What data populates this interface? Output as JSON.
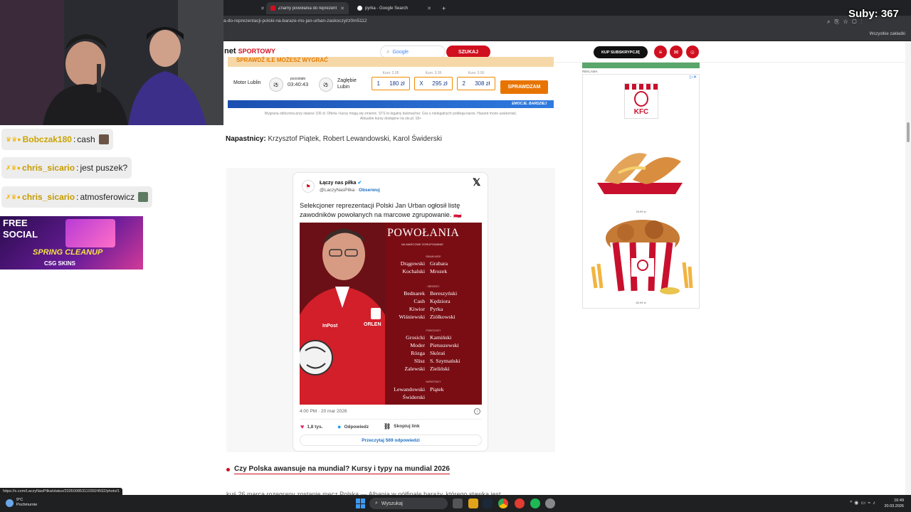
{
  "browser": {
    "tabs": [
      {
        "title": "Znamy powołania do reprezent",
        "active": true
      },
      {
        "title": "pyrka - Google Search",
        "active": false
      }
    ],
    "url": "a-do-reprezentacji-polski-na-baraze-ms-jan-urban-zaskoczyl/z0m5112",
    "bookmarks_all": "Wszystkie zakładki"
  },
  "site": {
    "brand_prefix": "net",
    "brand_name": "SPORTOWY",
    "search_placeholder": "Google",
    "search_button": "SZUKAJ",
    "subscribe_button": "KUP SUBSKRYPCJĘ"
  },
  "betting": {
    "banner": "SPRAWDŹ ILE MOŻESZ WYGRAĆ",
    "home_team": "Motor Lublin",
    "time_left_label": "pozostało",
    "time_left": "03:40:43",
    "away_team_line1": "Zagłębie",
    "away_team_line2": "Lubin",
    "odds": [
      {
        "label": "Kurs: 2.05",
        "pick": "1",
        "payout": "180 zł"
      },
      {
        "label": "Kurs: 3.35",
        "pick": "X",
        "payout": "295 zł"
      },
      {
        "label": "Kurs: 3.50",
        "pick": "2",
        "payout": "308 zł"
      }
    ],
    "check_button": "SPRAWDZAM",
    "footer_slogan": "EMOCJE. BARDZIEJ",
    "disclaimer_line1": "Wygrana obliczona przy stawce 100 zł. Oferta i kursy mogą się zmienić. STS to legalny bukmacher. Gra u nielegalnych podlega karze. Hazard może uzależniać.",
    "disclaimer_line2": "Aktualne kursy dostępne na sts.pl. 18+"
  },
  "article": {
    "strikers_label": "Napastnicy:",
    "strikers": " Krzysztof Piątek, Robert Lewandowski, Karol Świderski",
    "related_link": "Czy Polska awansuje na mundial? Kursy i typy na mundial 2026",
    "cut_line": "kuś 26 marca rozegrany zostanie mecz Polska — Albania w półfinale baraży, którego stawką jest"
  },
  "tweet": {
    "name": "Łączy nas piłka",
    "handle": "@LaczyNasPilka",
    "follow": "Obserwuj",
    "text": "Selekcjoner reprezentacji Polski Jan Urban ogłosił listę zawodników powołanych na marcowe zgrupowanie. 🇵🇱",
    "image_title": "POWOŁANIA",
    "image_subtitle": "NA MARCOWE ZGRUPOWANIE",
    "roles": {
      "gk": "BRAMKARZE",
      "def": "OBROŃCY",
      "mid": "POMOCNICY",
      "fwd": "NAPASTNICY"
    },
    "goalkeepers_left": [
      "Drągowski",
      "Kochalski"
    ],
    "goalkeepers_right": [
      "Grabara",
      "Mrozek"
    ],
    "defenders_left": [
      "Bednarek",
      "Cash",
      "Kiwior",
      "Wiśniewski"
    ],
    "defenders_right": [
      "Bereszyński",
      "Kędziora",
      "Pyrka",
      "Ziółkowski"
    ],
    "midfielders_left": [
      "Grosicki",
      "Moder",
      "Rózga",
      "Slisz",
      "Zalewski"
    ],
    "midfielders_right": [
      "Kamiński",
      "Pietuszewski",
      "Skóraś",
      "S. Szymański",
      "Zieliński"
    ],
    "forwards_left": [
      "Lewandowski",
      "Świderski"
    ],
    "forwards_right": [
      "Piątek"
    ],
    "sponsor1": "InPost",
    "sponsor2": "ORLEN",
    "date": "4:00 PM · 20 mar 2026",
    "likes": "1,8 tys.",
    "reply": "Odpowiedz",
    "copy_link": "Skopiuj link",
    "read_replies": "Przeczytaj 569 odpowiedzi"
  },
  "ad": {
    "label": "REKLAMA",
    "brand": "KFC",
    "price1": "29,99 zł",
    "price2": "82,99 zł"
  },
  "stream": {
    "subs": "Suby: 367",
    "chat": [
      {
        "user": "Bobczak180",
        "message": "cash"
      },
      {
        "user": "chris_sicario",
        "message": "jest puszek?"
      },
      {
        "user": "chris_sicario",
        "message": "atmosferowicz"
      }
    ],
    "promo_line1": "FREE",
    "promo_line2": "SOCIAL",
    "promo_line3": "SPRING CLEANUP",
    "promo_line4": "CSG SKINS"
  },
  "statusbar": {
    "hover_url": "https://x.com/LaczyNasPilka/status/2035008531103924592/photo/1"
  },
  "taskbar": {
    "temp": "9°C",
    "weather": "Pochmurnie",
    "search": "Wyszukaj",
    "time": "16:49",
    "date": "20.03.2026"
  }
}
